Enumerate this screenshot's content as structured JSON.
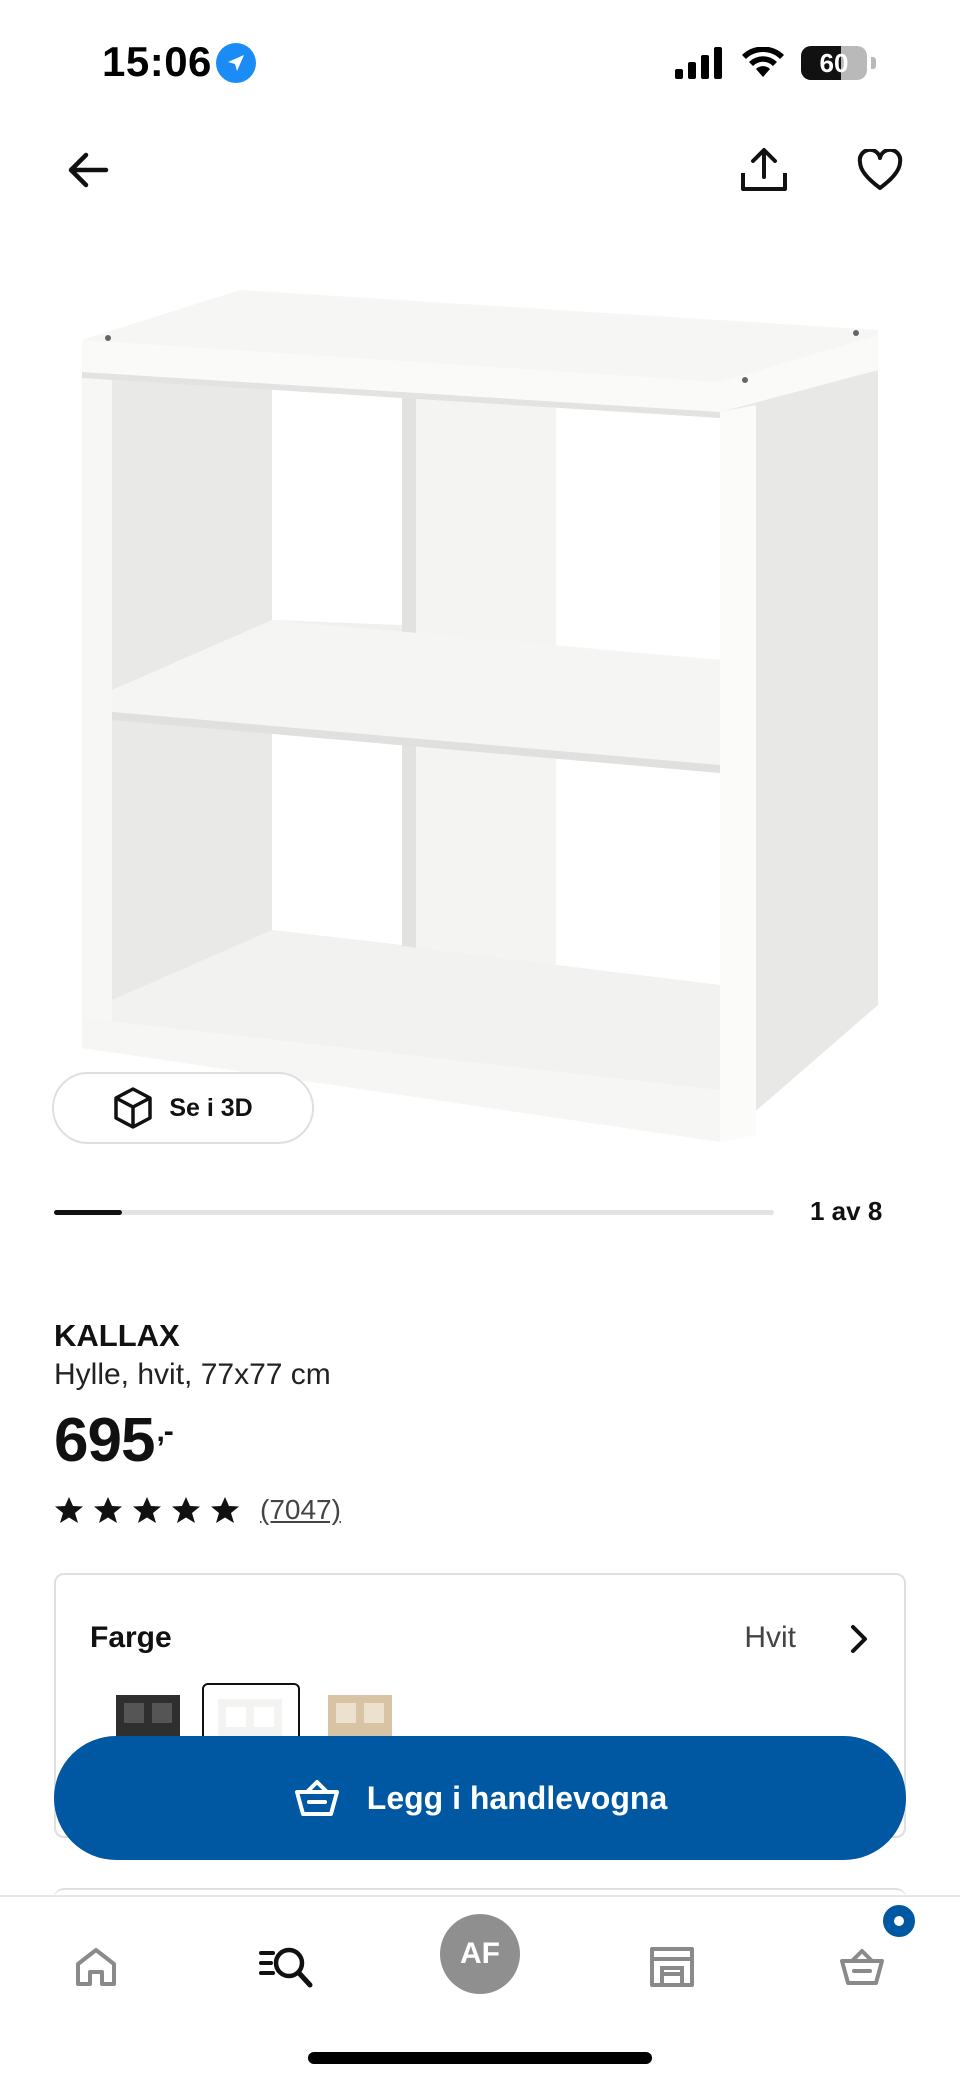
{
  "status_bar": {
    "time": "15:06",
    "battery": "60",
    "battery_fraction": 0.6
  },
  "product": {
    "name": "KALLAX",
    "description": "Hylle, hvit, 77x77 cm",
    "price": "695",
    "price_suffix": ",-",
    "rating_stars": 5,
    "review_count": "(7047)",
    "view_3d_label": "Se i 3D"
  },
  "gallery": {
    "counter": "1 av 8",
    "current": 1,
    "total": 8
  },
  "color": {
    "label": "Farge",
    "value": "Hvit",
    "swatches": [
      {
        "name": "Svart-brun",
        "color": "#3a3a3a",
        "selected": false
      },
      {
        "name": "Hvit",
        "color": "#f6f6f6",
        "selected": true
      },
      {
        "name": "Eikemønstret",
        "color": "#d8c3a5",
        "selected": false
      }
    ]
  },
  "cart_button": {
    "label": "Legg i handlevogna"
  },
  "nav": {
    "items": [
      "home-icon",
      "search-icon",
      "avatar",
      "store-icon",
      "cart-icon"
    ],
    "avatar_initials": "AF"
  },
  "colors": {
    "accent": "#0058a3",
    "location": "#1b8cf5"
  }
}
